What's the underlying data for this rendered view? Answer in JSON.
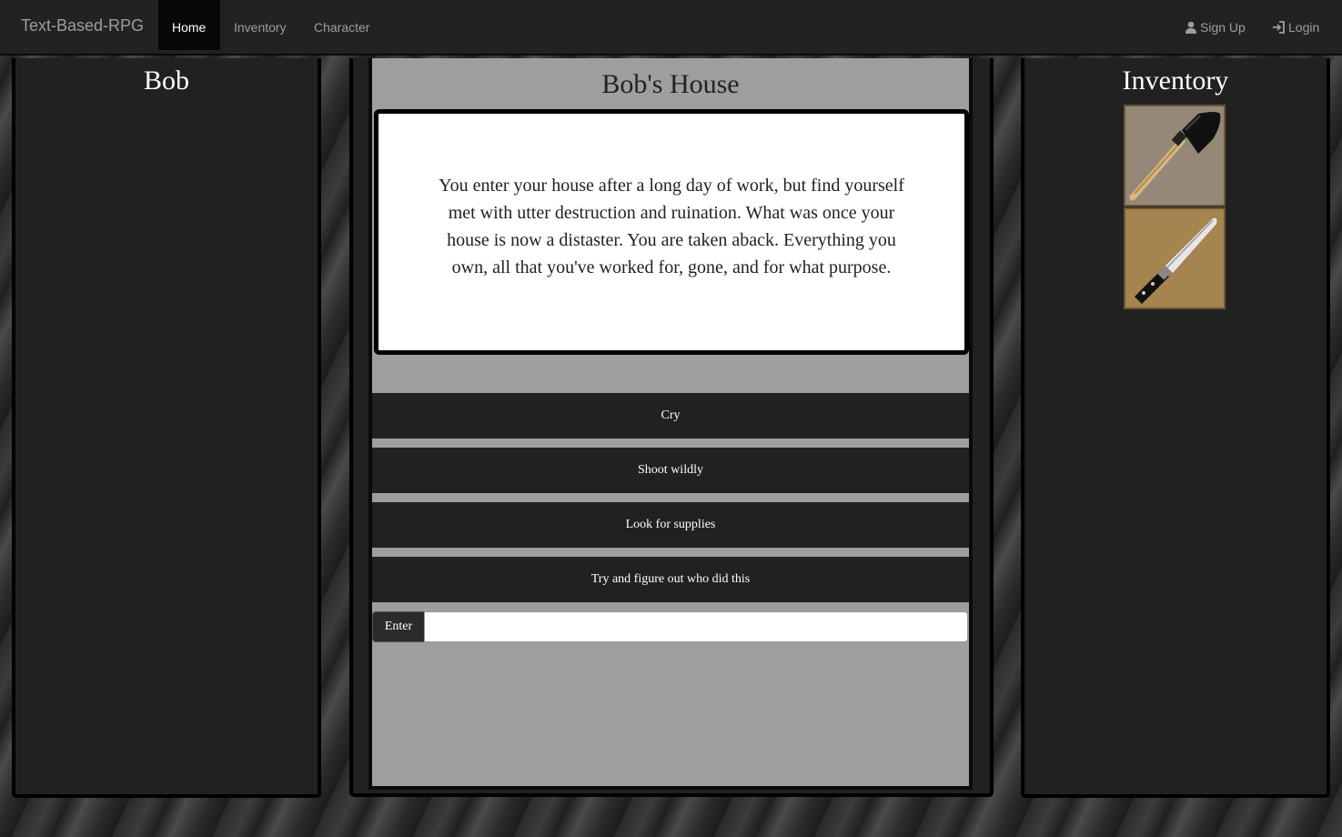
{
  "navbar": {
    "brand": "Text-Based-RPG",
    "links": [
      {
        "label": "Home",
        "active": true
      },
      {
        "label": "Inventory",
        "active": false
      },
      {
        "label": "Character",
        "active": false
      }
    ],
    "right": [
      {
        "label": "Sign Up",
        "icon": "user-icon"
      },
      {
        "label": "Login",
        "icon": "login-icon"
      }
    ]
  },
  "character": {
    "name": "Bob"
  },
  "location": {
    "title": "Bob's House",
    "description": "You enter your house after a long day of work, but find yourself met with utter destruction and ruination. What was once your house is now a distaster. You are taken aback. Everything you own, all that you've worked for, gone, and for what purpose."
  },
  "choices": [
    "Cry",
    "Shoot wildly",
    "Look for supplies",
    "Try and figure out who did this"
  ],
  "command": {
    "button_label": "Enter",
    "value": "",
    "placeholder": ""
  },
  "inventory": {
    "title": "Inventory",
    "items": [
      {
        "name": "shovel",
        "icon": "shovel-icon"
      },
      {
        "name": "knife",
        "icon": "knife-icon"
      }
    ]
  },
  "colors": {
    "navbar_bg": "#222222",
    "panel_bg": "#212121",
    "center_bg": "#9e9e9e",
    "story_bg": "#ffffff"
  }
}
